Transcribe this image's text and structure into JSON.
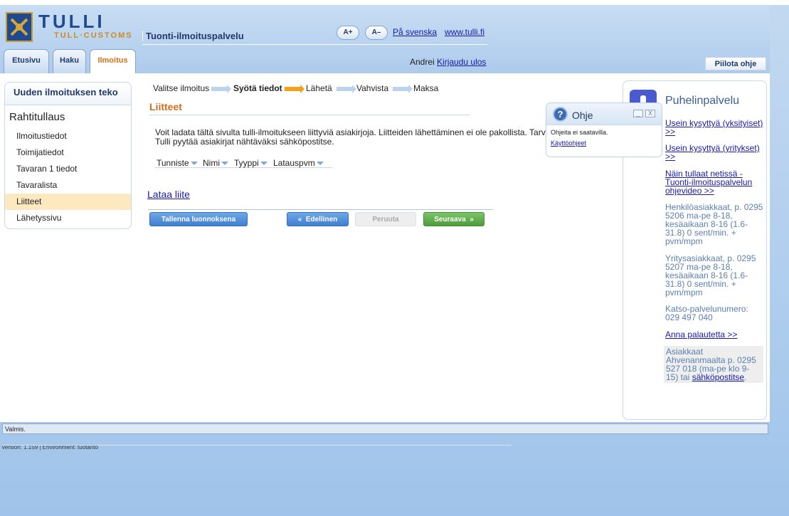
{
  "header": {
    "logo_text": "TULLI",
    "logo_subtext": "TULL·CUSTOMS",
    "service_name": "Tuonti-ilmoituspalvelu",
    "font_increase": "A+",
    "font_decrease": "A–",
    "swedish_link": "På svenska",
    "site_link": "www.tulli.fi"
  },
  "tabs": [
    {
      "label": "Etusivu",
      "active": false
    },
    {
      "label": "Haku",
      "active": false
    },
    {
      "label": "Ilmoitus",
      "active": true
    }
  ],
  "user": {
    "name": "Andrei",
    "logout": "Kirjaudu ulos"
  },
  "hide_help_button": "Piilota ohje",
  "left_panel": {
    "header": "Uuden ilmoituksen teko",
    "title": "Rahtitullaus",
    "items": [
      {
        "label": "Ilmoitustiedot",
        "active": false
      },
      {
        "label": "Toimijatiedot",
        "active": false
      },
      {
        "label": "Tavaran 1 tiedot",
        "active": false
      },
      {
        "label": "Tavaralista",
        "active": false
      },
      {
        "label": "Liitteet",
        "active": true
      },
      {
        "label": "Lähetyssivu",
        "active": false
      }
    ]
  },
  "steps": [
    {
      "label": "Valitse ilmoitus",
      "current": false
    },
    {
      "label": "Syötä tiedot",
      "current": true
    },
    {
      "label": "Lähetä",
      "current": false
    },
    {
      "label": "Vahvista",
      "current": false
    },
    {
      "label": "Maksa",
      "current": false
    }
  ],
  "section": {
    "title": "Liitteet",
    "description_line1": "Voit ladata tältä sivulta tulli-ilmoitukseen liittyviä asiakirjoja. Liitteiden lähettäminen ei ole pakollista. Tarvittaessa",
    "description_line2": "Tulli pyytää asiakirjat nähtäväksi sähköpostitse.",
    "columns": [
      "Tunniste",
      "Nimi",
      "Tyyppi",
      "Latauspvm"
    ],
    "upload_link": "Lataa liite"
  },
  "buttons": {
    "save_draft": "Tallenna luonnoksena",
    "previous": "Edellinen",
    "cancel": "Peruuta",
    "next": "Seuraava"
  },
  "help_popup": {
    "title": "Ohje",
    "minimize": "_",
    "close": "X",
    "text": "Ohjeita ei saatavilla.",
    "link": "Käyttöohjeet"
  },
  "right_panel": {
    "title": "Puhelinpalvelu",
    "faq_private": "Usein kysyttyä (yksityiset) >>",
    "faq_business": "Usein kysyttyä (yritykset) >>",
    "video_link": "Näin tullaat netissä - Tuonti-ilmoituspalvelun ohjevideo >>",
    "private_customers": "Henkilöasiakkaat, p. 0295 5206 ma-pe 8-18, kesäaikaan 8-16 (1.6-31.8) 0 sent/min. + pvm/mpm",
    "business_customers": "Yritysasiakkaat, p. 0295 5207 ma-pe 8-18, kesäaikaan 8-16 (1.6-31.8) 0 sent/min. + pvm/mpm",
    "katso_service": "Katso-palvelunumero: 029 497 040",
    "feedback_link": "Anna palautetta >>",
    "aland_text": "Asiakkaat Ahvenanmaalta p. 0295 527 018 (ma-pe klo 9-15) tai",
    "aland_email": "sähköpostitse",
    "aland_end": "."
  },
  "status_bar": "Valmis.",
  "version": "Version: 1.159 | Environment: tuotanto"
}
